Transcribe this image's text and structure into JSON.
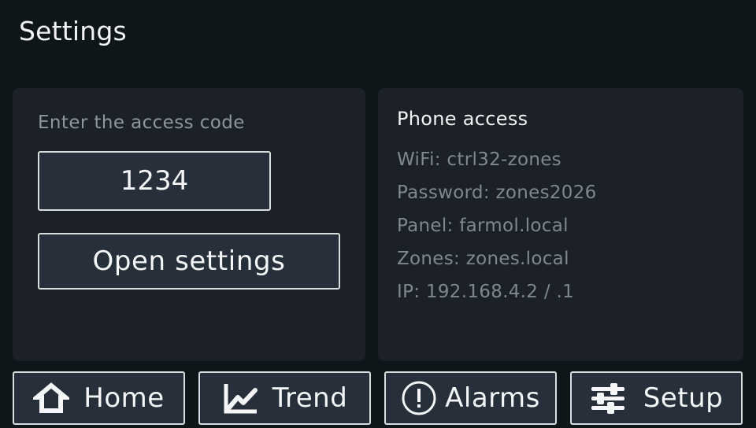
{
  "header": {
    "title": "Settings"
  },
  "access": {
    "prompt": "Enter the access code",
    "code_value": "1234",
    "open_label": "Open settings"
  },
  "phone": {
    "title": "Phone access",
    "lines": [
      "WiFi: ctrl32-zones",
      "Password: zones2026",
      "Panel: farmol.local",
      "Zones: zones.local",
      "IP: 192.168.4.2 / .1"
    ]
  },
  "nav": {
    "home": {
      "label": "Home",
      "icon": "home-icon"
    },
    "trend": {
      "label": "Trend",
      "icon": "trend-icon"
    },
    "alarms": {
      "label": "Alarms",
      "icon": "alert-circle-icon"
    },
    "setup": {
      "label": "Setup",
      "icon": "sliders-icon"
    }
  },
  "colors": {
    "background": "#0e161a",
    "panel": "#1b2127",
    "button": "#27303a",
    "border": "#d9dde0",
    "muted_text": "#7f888f"
  }
}
